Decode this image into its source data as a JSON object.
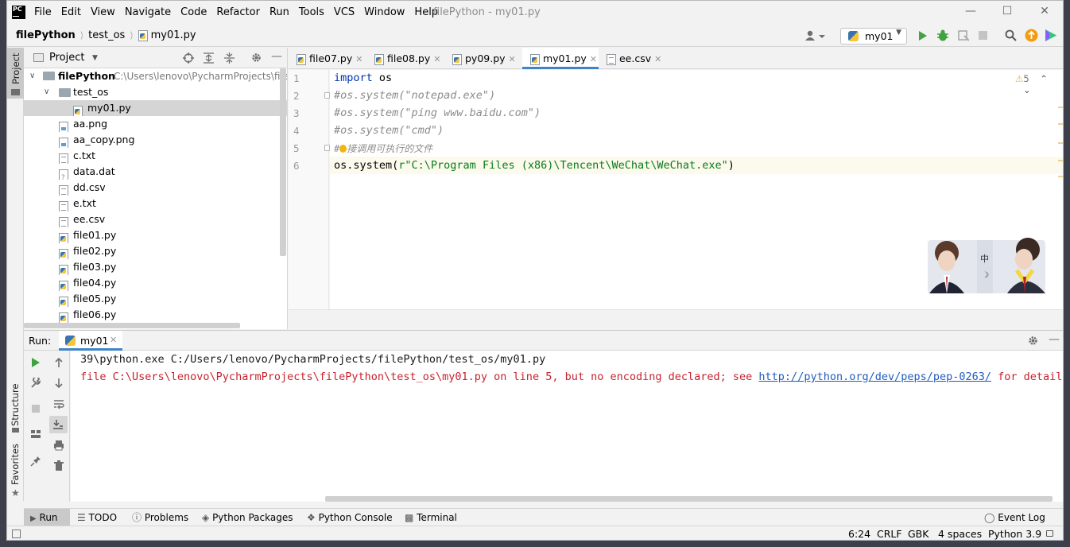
{
  "window": {
    "title": "filePython - my01.py",
    "menus": [
      "File",
      "Edit",
      "View",
      "Navigate",
      "Code",
      "Refactor",
      "Run",
      "Tools",
      "VCS",
      "Window",
      "Help"
    ]
  },
  "breadcrumb": [
    "filePython",
    "test_os",
    "my01.py"
  ],
  "run_config": "my01",
  "project": {
    "header": "Project",
    "root_name": "filePython",
    "root_path": "C:\\Users\\lenovo\\PycharmProjects\\fileP",
    "tree": [
      {
        "name": "test_os",
        "type": "folder",
        "indent": 1,
        "expanded": true
      },
      {
        "name": "my01.py",
        "type": "py",
        "indent": 2,
        "selected": true
      },
      {
        "name": "aa.png",
        "type": "img",
        "indent": 1
      },
      {
        "name": "aa_copy.png",
        "type": "img",
        "indent": 1
      },
      {
        "name": "c.txt",
        "type": "txt",
        "indent": 1
      },
      {
        "name": "data.dat",
        "type": "dat",
        "indent": 1
      },
      {
        "name": "dd.csv",
        "type": "txt",
        "indent": 1
      },
      {
        "name": "e.txt",
        "type": "txt",
        "indent": 1
      },
      {
        "name": "ee.csv",
        "type": "txt",
        "indent": 1
      },
      {
        "name": "file01.py",
        "type": "py",
        "indent": 1
      },
      {
        "name": "file02.py",
        "type": "py",
        "indent": 1
      },
      {
        "name": "file03.py",
        "type": "py",
        "indent": 1
      },
      {
        "name": "file04.py",
        "type": "py",
        "indent": 1
      },
      {
        "name": "file05.py",
        "type": "py",
        "indent": 1
      },
      {
        "name": "file06.py",
        "type": "py",
        "indent": 1
      }
    ]
  },
  "editor": {
    "tabs": [
      {
        "label": "file07.py",
        "type": "py"
      },
      {
        "label": "file08.py",
        "type": "py"
      },
      {
        "label": "py09.py",
        "type": "py"
      },
      {
        "label": "my01.py",
        "type": "py",
        "active": true
      },
      {
        "label": "ee.csv",
        "type": "txt"
      }
    ],
    "warnings": "5",
    "line_numbers": [
      "1",
      "2",
      "3",
      "4",
      "5",
      "6"
    ],
    "lines": [
      "import os",
      "#os.system(\"notepad.exe\")",
      "#os.system(\"ping www.baidu.com\")",
      "#os.system(\"cmd\")",
      "#直接调用可执行的文件",
      "os.system(r\"C:\\Program Files (x86)\\Tencent\\WeChat\\WeChat.exe\")"
    ],
    "code_parts": {
      "kw": "import",
      "mod": " os",
      "call": "os.system(",
      "str": "r\"C:\\Program Files (x86)\\Tencent\\WeChat\\WeChat.exe\"",
      "close": ")"
    },
    "comment5_first": "#",
    "comment5_rest": "接调用可执行的文件"
  },
  "run": {
    "label": "Run:",
    "tab": "my01",
    "output": [
      "39\\python.exe C:/Users/lenovo/PycharmProjects/filePython/test_os/my01.py",
      "file C:\\Users\\lenovo\\PycharmProjects\\filePython\\test_os\\my01.py on line 5, but no encoding declared; see "
    ],
    "link": "http://python.org/dev/peps/pep-0263/",
    "after_link": " for details"
  },
  "bottom_tabs": [
    "Run",
    "TODO",
    "Problems",
    "Python Packages",
    "Python Console",
    "Terminal",
    "Event Log"
  ],
  "side_tabs": {
    "project": "Project",
    "structure": "Structure",
    "favorites": "Favorites"
  },
  "status": {
    "position": "6:24",
    "line_sep": "CRLF",
    "encoding": "GBK",
    "indent": "4 spaces",
    "interpreter": "Python 3.9"
  }
}
